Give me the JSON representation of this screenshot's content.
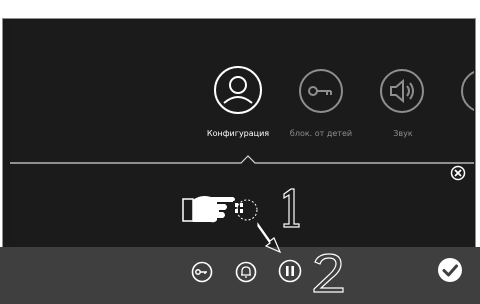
{
  "menu": {
    "items": [
      {
        "label": "Конфигурация",
        "icon": "person-icon",
        "active": true
      },
      {
        "label": "блок. от детей",
        "icon": "key-icon",
        "active": false
      },
      {
        "label": "Звук",
        "icon": "speaker-icon",
        "active": false
      }
    ]
  },
  "annotations": {
    "step1": "1",
    "step2": "2"
  },
  "bottom_bar": {
    "icons": [
      "key-icon",
      "bell-icon",
      "pause-icon",
      "checkmark-icon"
    ]
  },
  "colors": {
    "screen_bg": "#1b1b1b",
    "bar_bg": "#3f3f3f",
    "active_text": "#ffffff",
    "inactive_text": "#8e8e8e"
  }
}
